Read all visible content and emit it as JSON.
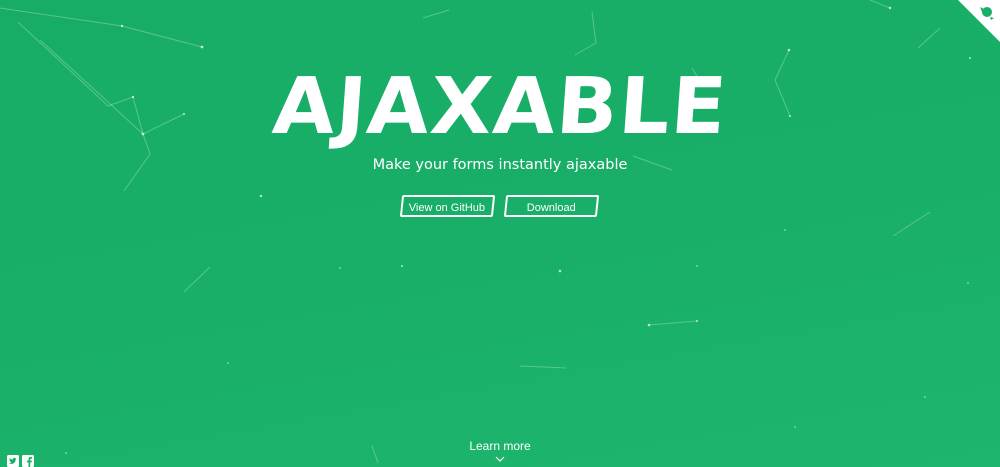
{
  "hero": {
    "title": "AJAXABLE",
    "subtitle": "Make your forms instantly ajaxable"
  },
  "buttons": {
    "github_label": "View on GitHub",
    "download_label": "Download"
  },
  "footer": {
    "learn_more_label": "Learn more"
  },
  "social": {
    "icons": [
      "twitter-icon",
      "facebook-icon"
    ]
  },
  "corner": {
    "icon": "octocat-icon"
  },
  "colors": {
    "background": "#19af69",
    "foreground": "#ffffff"
  }
}
